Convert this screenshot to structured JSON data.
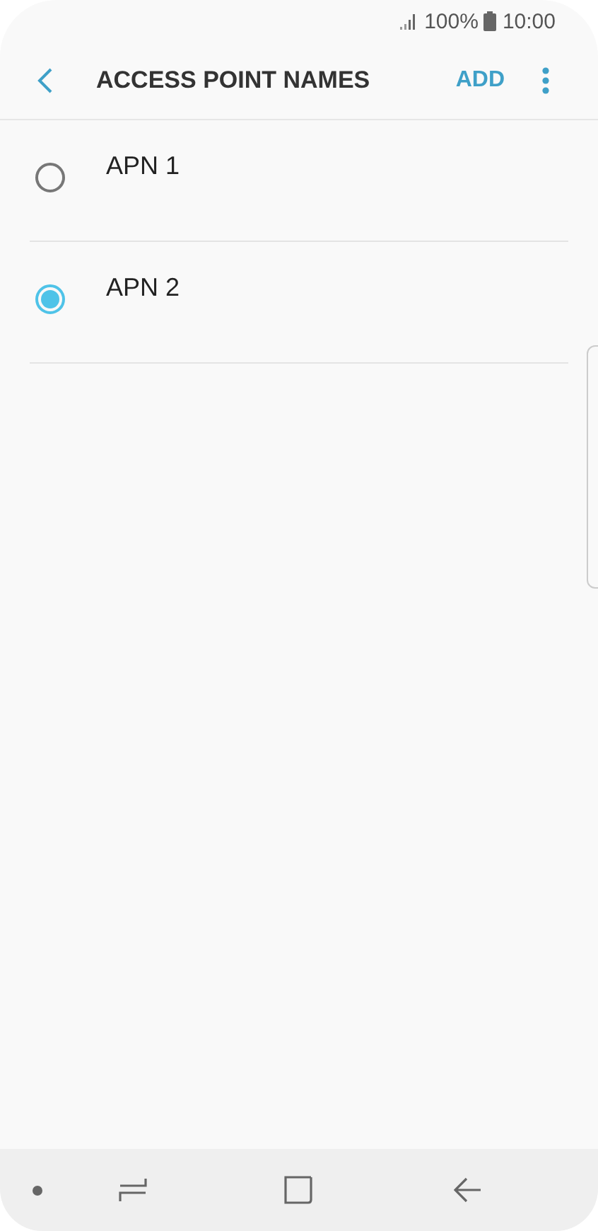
{
  "status_bar": {
    "battery": "100%",
    "time": "10:00"
  },
  "header": {
    "title": "ACCESS POINT NAMES",
    "action": "ADD"
  },
  "apns": [
    {
      "name": "APN 1",
      "selected": false
    },
    {
      "name": "APN 2",
      "selected": true
    }
  ]
}
